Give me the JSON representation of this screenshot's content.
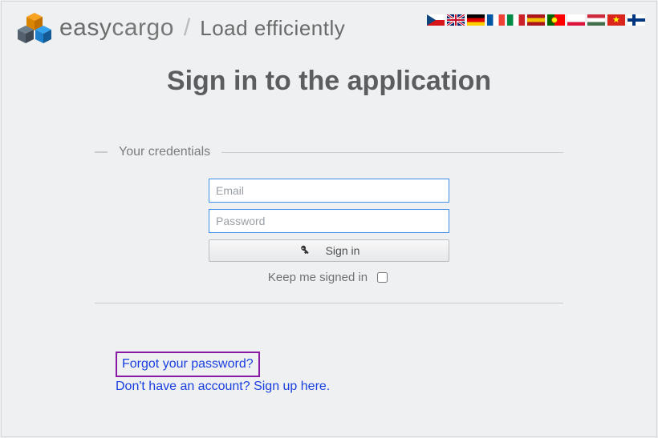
{
  "brand": {
    "easy": "easy",
    "cargo": "cargo",
    "tagline": "Load efficiently"
  },
  "page_title": "Sign in to the application",
  "legend": "Your credentials",
  "form": {
    "email_placeholder": "Email",
    "password_placeholder": "Password",
    "signin_label": "Sign in",
    "keep_label": "Keep me signed in"
  },
  "links": {
    "forgot": "Forgot your password?",
    "signup": "Don't have an account? Sign up here."
  },
  "flags": [
    {
      "name": "czech",
      "colors": [
        "#11457e",
        "#ffffff",
        "#d7141a"
      ]
    },
    {
      "name": "uk",
      "colors": [
        "#012169",
        "#ffffff",
        "#c8102e"
      ]
    },
    {
      "name": "germany",
      "colors": [
        "#000000",
        "#dd0000",
        "#ffce00"
      ]
    },
    {
      "name": "france",
      "colors": [
        "#0055a4",
        "#ffffff",
        "#ef4135"
      ]
    },
    {
      "name": "italy",
      "colors": [
        "#008c45",
        "#ffffff",
        "#cd212a"
      ]
    },
    {
      "name": "spain",
      "colors": [
        "#aa151b",
        "#f1bf00",
        "#aa151b"
      ]
    },
    {
      "name": "portugal",
      "colors": [
        "#006600",
        "#ff0000",
        "#ff0000"
      ]
    },
    {
      "name": "poland",
      "colors": [
        "#ffffff",
        "#ffffff",
        "#dc143c"
      ]
    },
    {
      "name": "hungary",
      "colors": [
        "#cd2a3e",
        "#ffffff",
        "#436f4d"
      ]
    },
    {
      "name": "vietnam",
      "colors": [
        "#da251d",
        "#da251d",
        "#da251d"
      ]
    },
    {
      "name": "finland",
      "colors": [
        "#ffffff",
        "#003580",
        "#ffffff"
      ]
    }
  ]
}
